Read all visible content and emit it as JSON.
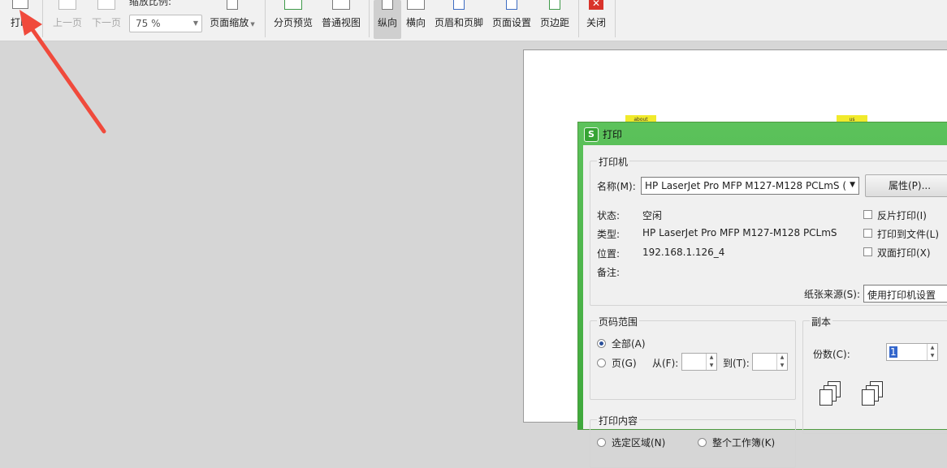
{
  "toolbar": {
    "print": "打印",
    "prev_page": "上一页",
    "next_page": "下一页",
    "zoom_ratio_label": "缩放比例:",
    "zoom_value": "75 %",
    "page_zoom": "页面缩放",
    "page_break_preview": "分页预览",
    "normal_view": "普通视图",
    "portrait": "纵向",
    "landscape": "横向",
    "header_footer": "页眉和页脚",
    "page_setup": "页面设置",
    "margins": "页边距",
    "close": "关闭",
    "close_color": "#d9332b",
    "active_item": "纵向"
  },
  "preview": {
    "tag_about": "about",
    "tag_us": "us",
    "tag_color": "#f1ea2b"
  },
  "annotation_arrow_color": "#f04a3c",
  "dialog": {
    "title": "打印",
    "app_icon_glyph": "S",
    "printer_group": {
      "title": "打印机",
      "name_label": "名称(M):",
      "name_value": "HP LaserJet Pro MFP M127-M128 PCLmS (",
      "properties_button": "属性(P)...",
      "status_label": "状态:",
      "status_value": "空闲",
      "type_label": "类型:",
      "type_value": "HP LaserJet Pro MFP M127-M128 PCLmS",
      "location_label": "位置:",
      "location_value": "192.168.1.126_4",
      "comment_label": "备注:",
      "reverse_print": "反片打印(I)",
      "print_to_file": "打印到文件(L)",
      "duplex": "双面打印(X)",
      "paper_source_label": "纸张来源(S):",
      "paper_source_value": "使用打印机设置"
    },
    "page_range": {
      "title": "页码范围",
      "all": "全部(A)",
      "pages": "页(G)",
      "from": "从(F):",
      "to": "到(T):",
      "selected": "全部(A)"
    },
    "copies": {
      "title": "副本",
      "count_label": "份数(C):",
      "count_value": "1"
    },
    "print_content": {
      "title": "打印内容",
      "selection": "选定区域(N)",
      "entire_workbook": "整个工作簿(K)"
    }
  }
}
